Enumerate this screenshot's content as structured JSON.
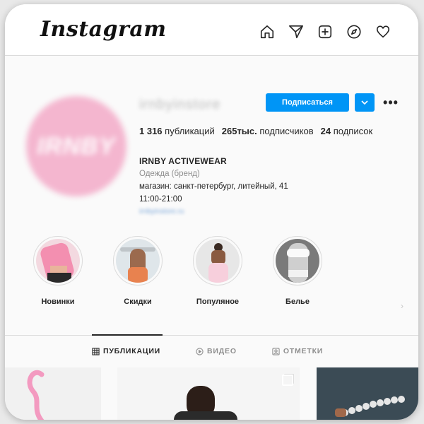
{
  "app": {
    "logo": "Instagram"
  },
  "nav": {
    "icons": [
      "home-icon",
      "direct-icon",
      "new-post-icon",
      "explore-icon",
      "activity-icon"
    ]
  },
  "profile": {
    "avatar_text": "IRNBY",
    "username": "irnbyinstore",
    "follow_label": "Подписаться",
    "more_label": "•••",
    "stats": {
      "posts_count": "1 316",
      "posts_label": "публикаций",
      "followers_count": "265тыс.",
      "followers_label": "подписчиков",
      "following_count": "24",
      "following_label": "подписок"
    },
    "bio": {
      "name": "IRNBY ACTIVEWEAR",
      "category": "Одежда (бренд)",
      "line1": "магазин: санкт-петербург, литейный, 41",
      "line2": "11:00-21:00",
      "link": "irnbyinstore.ru"
    }
  },
  "highlights": [
    {
      "label": "Новинки",
      "icon": "pink-top-image"
    },
    {
      "label": "Скидки",
      "icon": "back-pose-image"
    },
    {
      "label": "Популяное",
      "icon": "pink-leggings-image"
    },
    {
      "label": "Белье",
      "icon": "white-bra-image"
    }
  ],
  "tabs": [
    {
      "label": "ПУБЛИКАЦИИ",
      "icon": "grid-icon",
      "active": true
    },
    {
      "label": "ВИДЕО",
      "icon": "play-icon",
      "active": false
    },
    {
      "label": "ОТМЕТКИ",
      "icon": "tagged-icon",
      "active": false
    }
  ],
  "colors": {
    "accent": "#0095f6",
    "avatar_pink": "#f4b6cf",
    "text": "#262626",
    "muted": "#8e8e8e"
  }
}
